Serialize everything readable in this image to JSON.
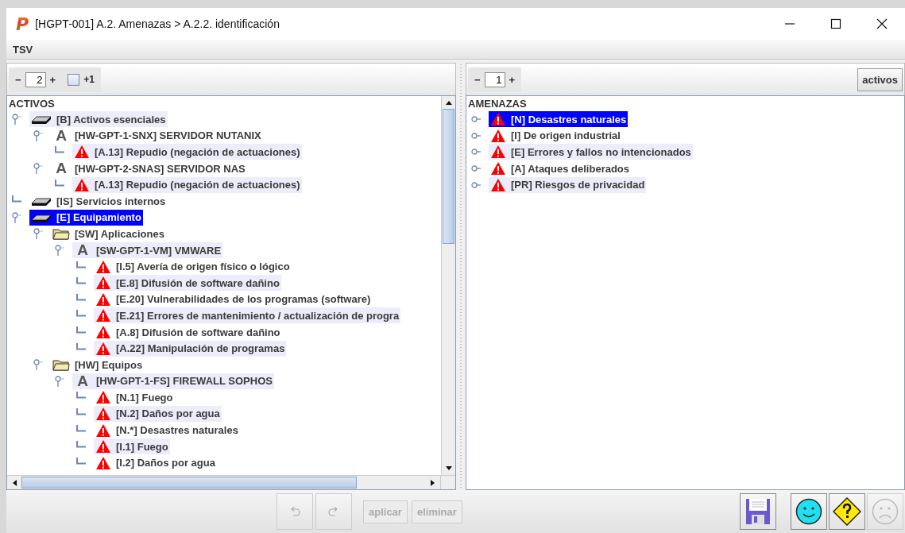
{
  "window": {
    "logo": "P",
    "title": "[HGPT-001] A.2. Amenazas > A.2.2. identificación"
  },
  "menu": [
    "TSV"
  ],
  "left_panel": {
    "toolbar": {
      "minus": "−",
      "value": "2",
      "plus": "+",
      "checkbox": {
        "checked": false,
        "label": "+1"
      }
    },
    "tree": {
      "root": "ACTIVOS",
      "nodes": [
        {
          "kind": "layer",
          "label": "[B] Activos esenciales",
          "selected": false,
          "highlighted": true,
          "expanded": true,
          "children": [
            {
              "kind": "asset",
              "glyph": "A",
              "label": "[HW-GPT-1-SNX] SERVIDOR NUTANIX",
              "selected": false,
              "highlighted": false,
              "expanded": true,
              "children": [
                {
                  "kind": "threat",
                  "label": "[A.13] Repudio (negación de actuaciones)",
                  "selected": false,
                  "highlighted": true
                }
              ]
            },
            {
              "kind": "asset",
              "glyph": "A",
              "label": "[HW-GPT-2-SNAS] SERVIDOR NAS",
              "selected": false,
              "highlighted": false,
              "expanded": true,
              "children": [
                {
                  "kind": "threat",
                  "label": "[A.13] Repudio (negación de actuaciones)",
                  "selected": false,
                  "highlighted": true
                }
              ]
            }
          ]
        },
        {
          "kind": "layer",
          "label": "[IS] Servicios internos",
          "selected": false,
          "highlighted": false
        },
        {
          "kind": "layer",
          "label": "[E] Equipamiento",
          "selected": true,
          "highlighted": false,
          "expanded": true,
          "children": [
            {
              "kind": "folder",
              "label": "[SW] Aplicaciones",
              "selected": false,
              "highlighted": false,
              "expanded": true,
              "children": [
                {
                  "kind": "asset",
                  "glyph": "A",
                  "label": "[SW-GPT-1-VM] VMWARE",
                  "selected": false,
                  "highlighted": true,
                  "expanded": true,
                  "children": [
                    {
                      "kind": "threat",
                      "label": "[I.5] Avería de origen físico o lógico",
                      "selected": false,
                      "highlighted": false
                    },
                    {
                      "kind": "threat",
                      "label": "[E.8] Difusión de software dañino",
                      "selected": false,
                      "highlighted": true
                    },
                    {
                      "kind": "threat",
                      "label": "[E.20] Vulnerabilidades de los programas (software)",
                      "selected": false,
                      "highlighted": false
                    },
                    {
                      "kind": "threat",
                      "label": "[E.21] Errores de mantenimiento / actualización de progra",
                      "selected": false,
                      "highlighted": true
                    },
                    {
                      "kind": "threat",
                      "label": "[A.8] Difusión de software dañino",
                      "selected": false,
                      "highlighted": false
                    },
                    {
                      "kind": "threat",
                      "label": "[A.22] Manipulación de programas",
                      "selected": false,
                      "highlighted": true
                    }
                  ]
                }
              ]
            },
            {
              "kind": "folder",
              "label": "[HW] Equipos",
              "selected": false,
              "highlighted": false,
              "expanded": true,
              "children": [
                {
                  "kind": "asset",
                  "glyph": "A",
                  "label": "[HW-GPT-1-FS] FIREWALL SOPHOS",
                  "selected": false,
                  "highlighted": true,
                  "expanded": true,
                  "children": [
                    {
                      "kind": "threat",
                      "label": "[N.1] Fuego",
                      "selected": false,
                      "highlighted": false
                    },
                    {
                      "kind": "threat",
                      "label": "[N.2] Daños por agua",
                      "selected": false,
                      "highlighted": true
                    },
                    {
                      "kind": "threat",
                      "label": "[N.*] Desastres naturales",
                      "selected": false,
                      "highlighted": false
                    },
                    {
                      "kind": "threat",
                      "label": "[I.1] Fuego",
                      "selected": false,
                      "highlighted": true
                    },
                    {
                      "kind": "threat",
                      "label": "[I.2] Daños por agua",
                      "selected": false,
                      "highlighted": false
                    }
                  ]
                }
              ]
            }
          ]
        }
      ]
    }
  },
  "right_panel": {
    "toolbar": {
      "minus": "−",
      "value": "1",
      "plus": "+",
      "button": "activos"
    },
    "tree": {
      "root": "AMENAZAS",
      "nodes": [
        {
          "kind": "threat",
          "label": "[N] Desastres naturales",
          "selected": true,
          "highlighted": false,
          "expanded": false
        },
        {
          "kind": "threat",
          "label": "[I] De origen industrial",
          "selected": false,
          "highlighted": false,
          "expanded": false
        },
        {
          "kind": "threat",
          "label": "[E] Errores y fallos no intencionados",
          "selected": false,
          "highlighted": true,
          "expanded": false
        },
        {
          "kind": "threat",
          "label": "[A] Ataques deliberados",
          "selected": false,
          "highlighted": false,
          "expanded": false
        },
        {
          "kind": "threat",
          "label": "[PR] Riesgos de privacidad",
          "selected": false,
          "highlighted": true,
          "expanded": false
        }
      ]
    }
  },
  "bottom_bar": {
    "undo": {
      "disabled": true
    },
    "redo": {
      "disabled": true
    },
    "buttons": [
      {
        "label": "aplicar",
        "disabled": true
      },
      {
        "label": "eliminar",
        "disabled": true
      }
    ],
    "save": {
      "disabled": false
    },
    "happy": {
      "disabled": false
    },
    "help": {
      "disabled": false
    },
    "sad": {
      "disabled": true
    }
  }
}
